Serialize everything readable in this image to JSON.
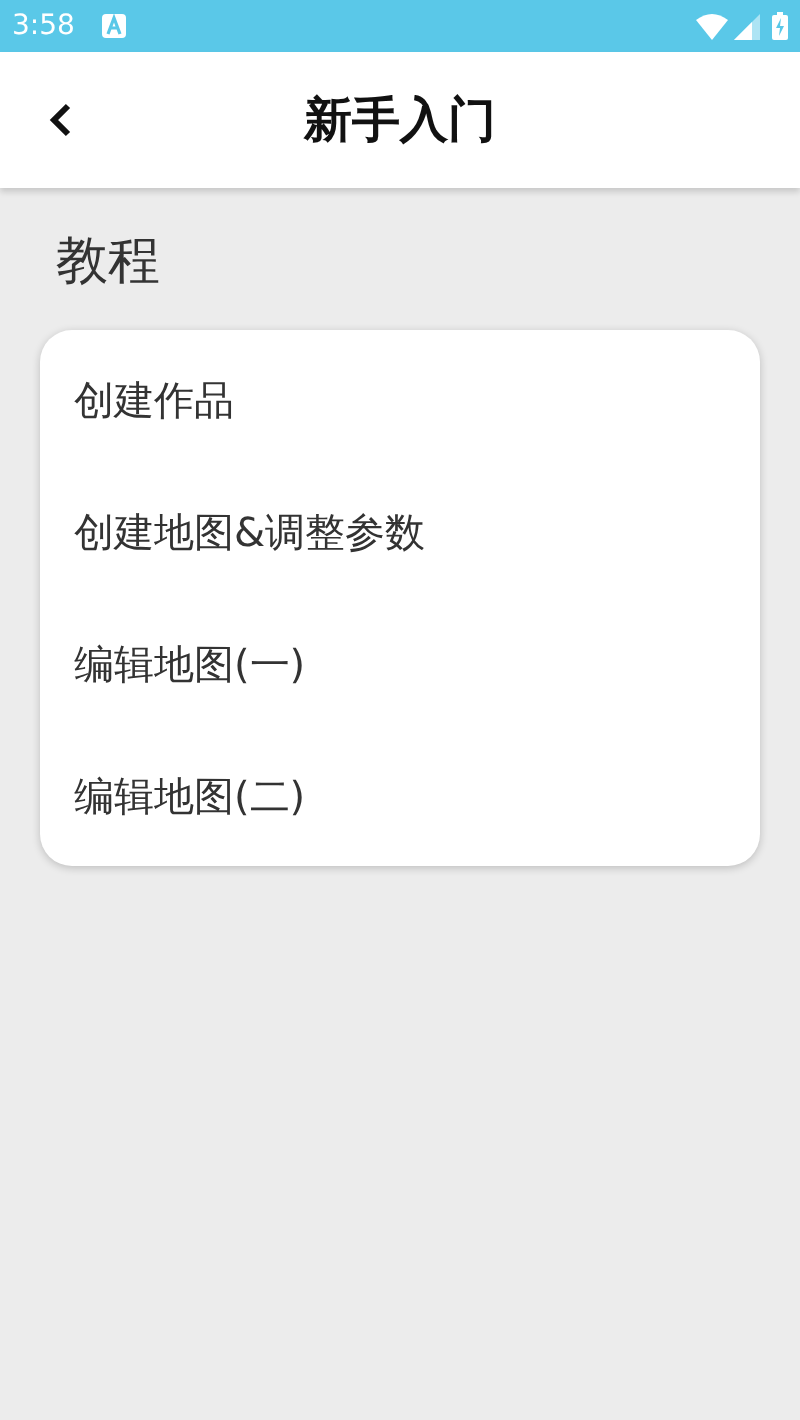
{
  "status_bar": {
    "time": "3:58"
  },
  "header": {
    "title": "新手入门"
  },
  "section": {
    "title": "教程"
  },
  "items": [
    {
      "label": "创建作品"
    },
    {
      "label": "创建地图&调整参数"
    },
    {
      "label": "编辑地图(一)"
    },
    {
      "label": "编辑地图(二)"
    }
  ]
}
